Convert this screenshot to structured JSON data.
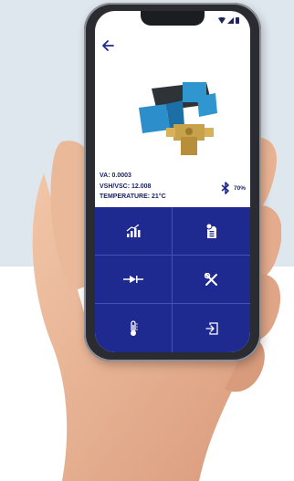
{
  "screen": {
    "back_icon": "arrow-left-icon",
    "status_icons": [
      "wifi-icon",
      "signal-icon",
      "battery-icon"
    ],
    "product_image": "valve-actuator-image"
  },
  "readings": {
    "va": "VA: 0.0003",
    "vsh_vsc": "VSH/VSC: 12.008",
    "temperature": "TEMPERATURE: 21°C"
  },
  "connection": {
    "icon": "bluetooth-icon",
    "level": "70%"
  },
  "menu": [
    {
      "name": "chart-button",
      "icon": "bar-chart-icon"
    },
    {
      "name": "document-button",
      "icon": "document-settings-icon"
    },
    {
      "name": "diode-button",
      "icon": "diode-icon"
    },
    {
      "name": "tools-button",
      "icon": "tools-icon"
    },
    {
      "name": "temperature-button",
      "icon": "thermometer-icon"
    },
    {
      "name": "export-button",
      "icon": "export-icon"
    }
  ],
  "colors": {
    "accent": "#1f2a90",
    "text": "#1d2460",
    "background": "#dfe7ee"
  }
}
